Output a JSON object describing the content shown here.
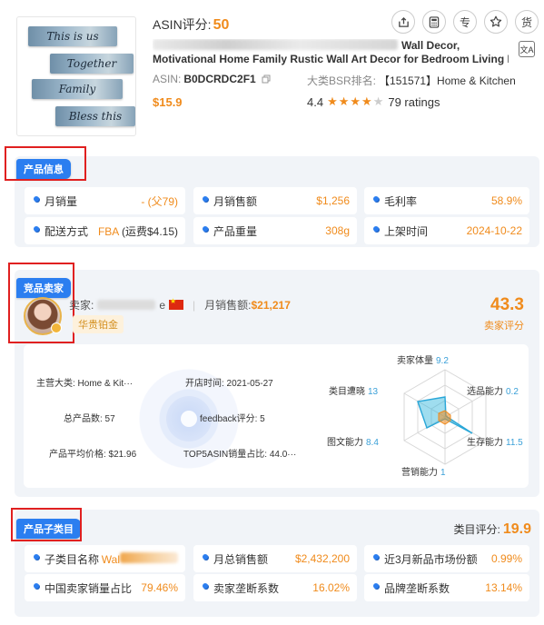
{
  "product": {
    "asin_score_label": "ASIN评分:",
    "asin_score": "50",
    "image_words": [
      "This is us",
      "Together",
      "Family",
      "Bless this"
    ],
    "title_line1_end": "Wall Decor,",
    "title_line2": "Motivational Home Family Rustic Wall Art Decor for Bedroom Living Room,…",
    "asin_label": "ASIN:",
    "asin": "B0DCRDC2F1",
    "bsr_label": "大类BSR排名:",
    "bsr_value": "【151571】Home & Kitchen",
    "price": "$15.9",
    "rating": "4.4",
    "ratings_count": "79 ratings",
    "tools": [
      "share-icon",
      "calculator-icon",
      "专",
      "star-icon",
      "货"
    ]
  },
  "product_info": {
    "tag": "产品信息",
    "cells": [
      {
        "label": "月销量",
        "value": "- (父79)"
      },
      {
        "label": "月销售额",
        "value": "$1,256"
      },
      {
        "label": "毛利率",
        "value": "58.9%"
      },
      {
        "label": "配送方式",
        "value": "FBA",
        "value_extra": "(运费$4.15)"
      },
      {
        "label": "产品重量",
        "value": "308g"
      },
      {
        "label": "上架时间",
        "value": "2024-10-22"
      }
    ]
  },
  "seller": {
    "tag": "竞品卖家",
    "seller_label": "卖家:",
    "seller_name_suffix": "e",
    "monthly_sales_label": "月销售额:",
    "monthly_sales": "$21,217",
    "level": "华贵铂金",
    "score": "43.3",
    "score_label": "卖家评分",
    "details": {
      "main_category": "主营大类:  Home & Kit···",
      "open_time": "开店时间:  2021-05-27",
      "total_products": "总产品数:  57",
      "feedback": "feedback评分:  5",
      "avg_price": "产品平均价格:  $21.96",
      "top5": "TOP5ASIN销量占比:  44.0···"
    },
    "radar": [
      {
        "label": "卖家体量",
        "value": "9.2"
      },
      {
        "label": "选品能力",
        "value": "0.2"
      },
      {
        "label": "生存能力",
        "value": "11.5"
      },
      {
        "label": "营销能力",
        "value": "1"
      },
      {
        "label": "图文能力",
        "value": "8.4"
      },
      {
        "label": "类目遭晓",
        "value": "13"
      }
    ]
  },
  "subcategory": {
    "tag": "产品子类目",
    "score_label": "类目评分:",
    "score": "19.9",
    "cells": [
      {
        "label": "子类目名称",
        "value": "Wal"
      },
      {
        "label": "月总销售额",
        "value": "$2,432,200"
      },
      {
        "label": "近3月新品市场份额",
        "value": "0.99%"
      },
      {
        "label": "中国卖家销量占比",
        "value": "79.46%"
      },
      {
        "label": "卖家垄断系数",
        "value": "16.02%"
      },
      {
        "label": "品牌垄断系数",
        "value": "13.14%"
      }
    ]
  },
  "colors": {
    "accent": "#f08b1c",
    "blue": "#2b7ef0",
    "highlight": "#e02020"
  }
}
